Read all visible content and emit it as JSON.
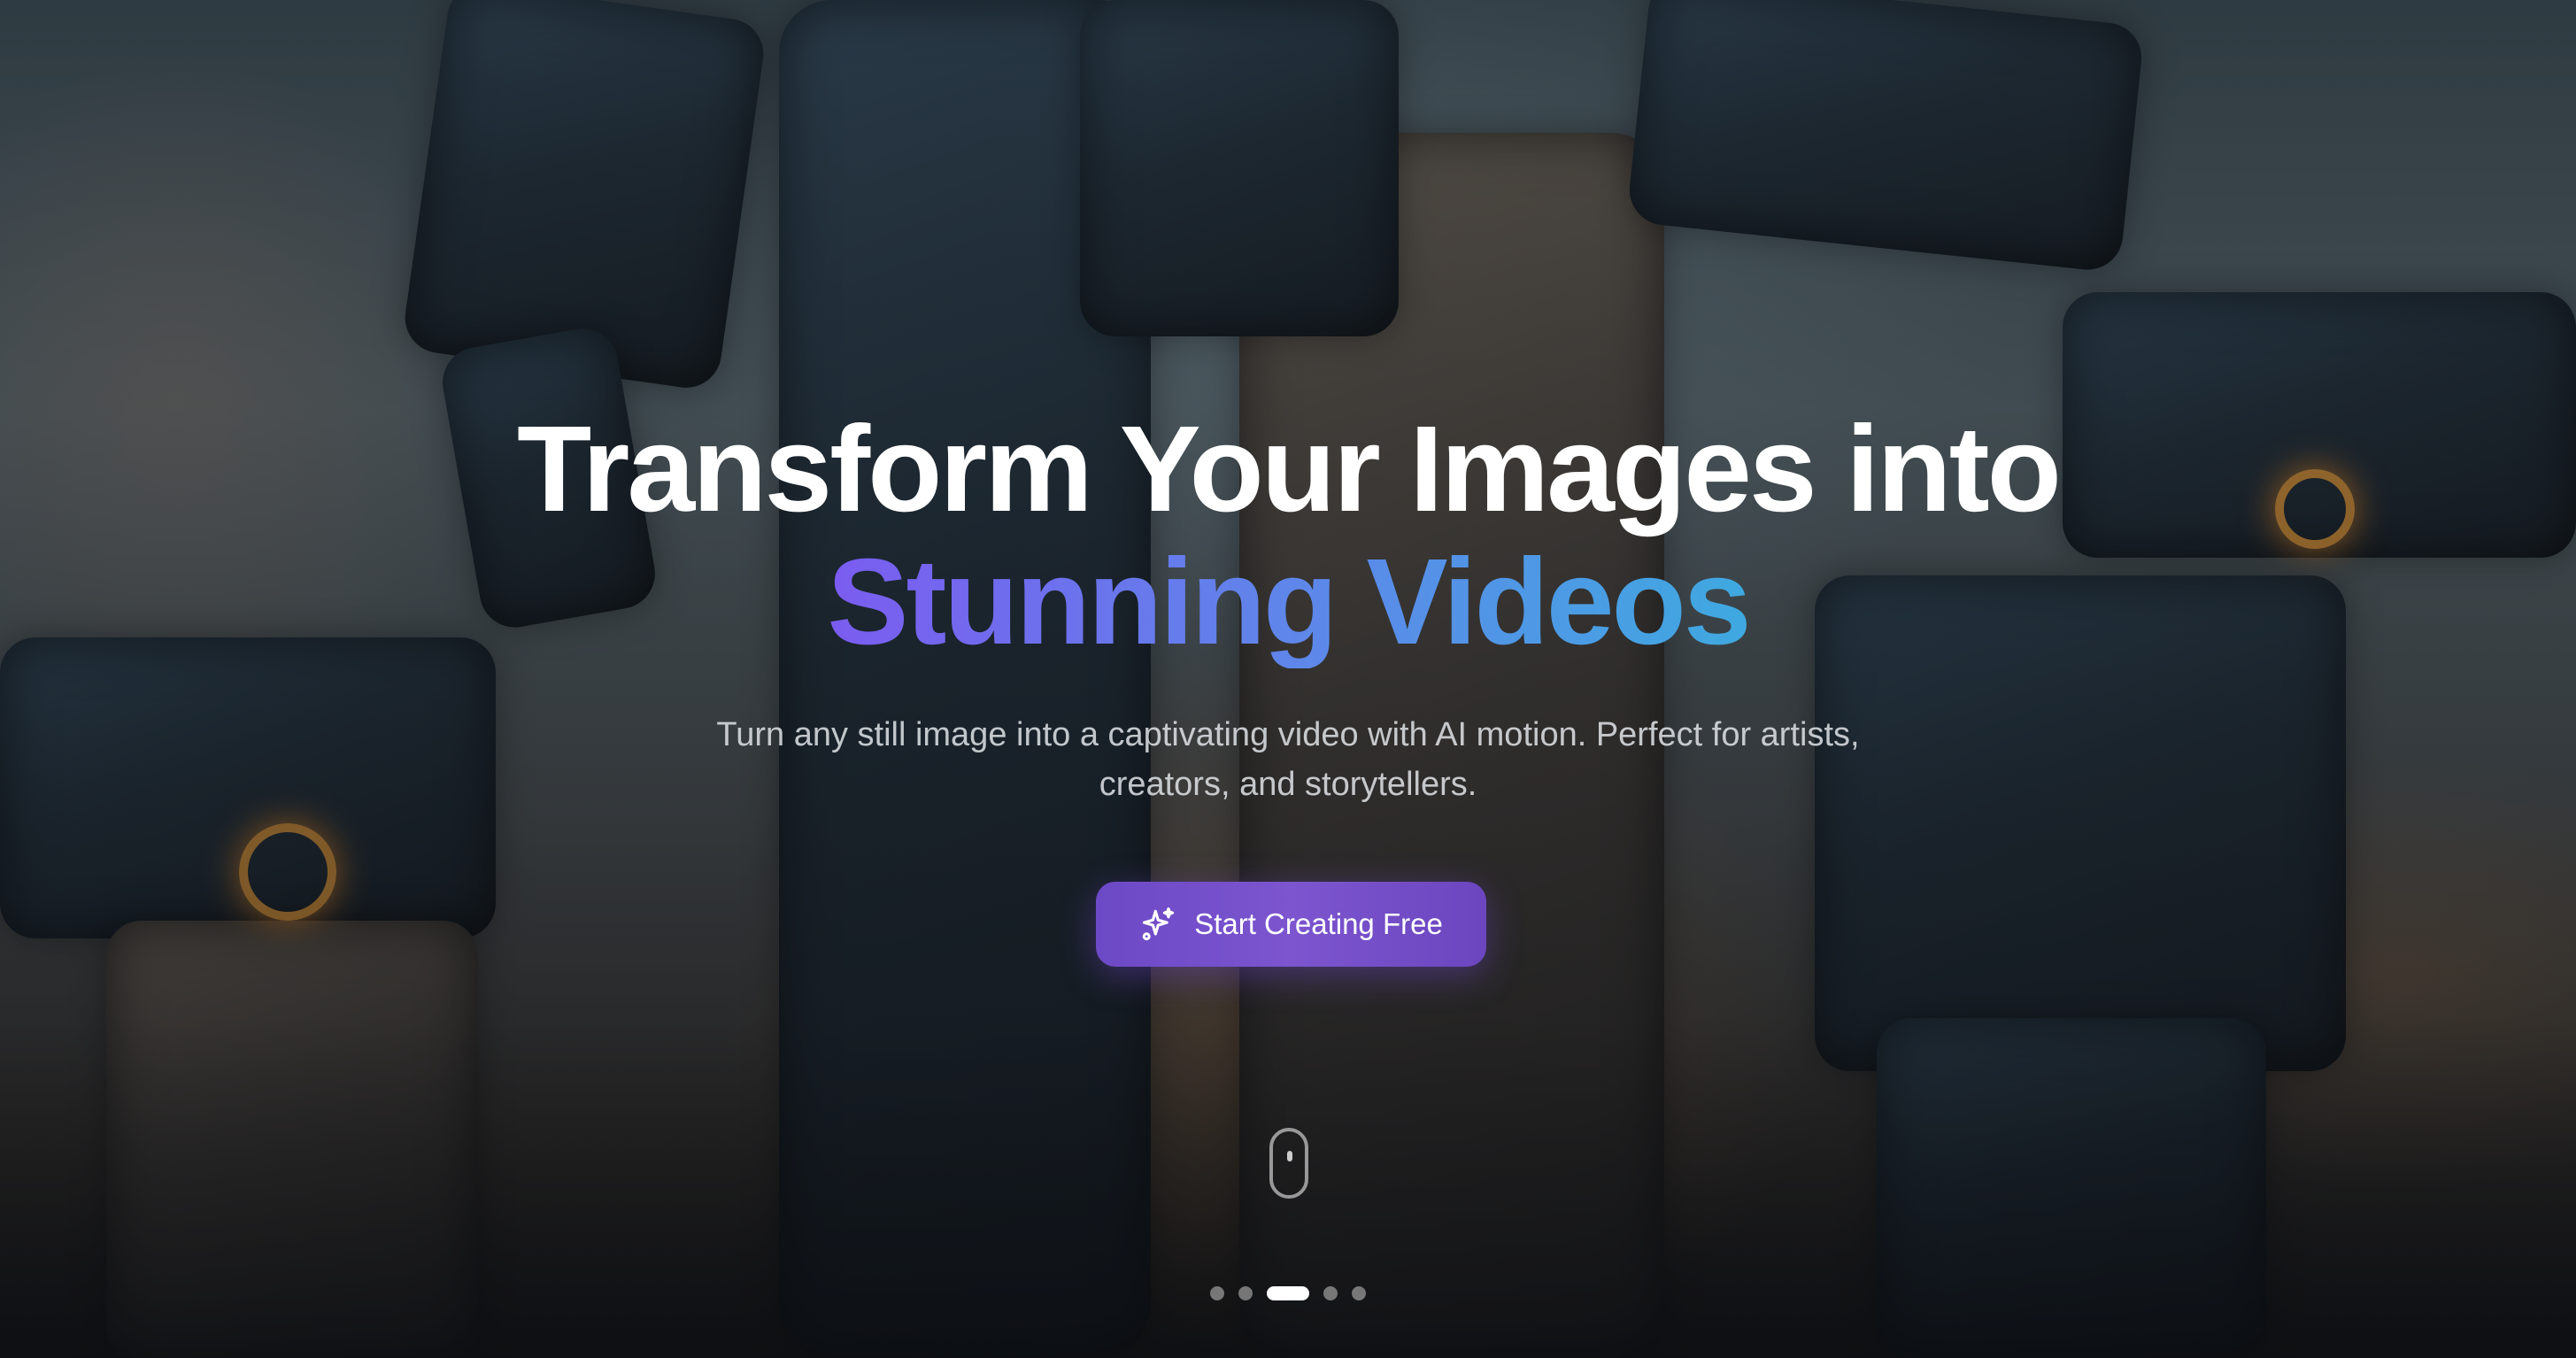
{
  "hero": {
    "headline_line1": "Transform Your Images into",
    "headline_line2": "Stunning Videos",
    "subtitle": "Turn any still image into a captivating video with AI motion. Perfect for artists, creators, and storytellers.",
    "cta_label": "Start Creating Free",
    "cta_icon": "sparkles-icon"
  },
  "scroll_indicator": {
    "icon": "mouse-icon"
  },
  "carousel": {
    "total_slides": 5,
    "active_index": 2
  },
  "colors": {
    "gradient_start": "#7b5cf0",
    "gradient_end": "#3fa9e0",
    "cta_background": "#7350c9",
    "text_primary": "#ffffff"
  }
}
